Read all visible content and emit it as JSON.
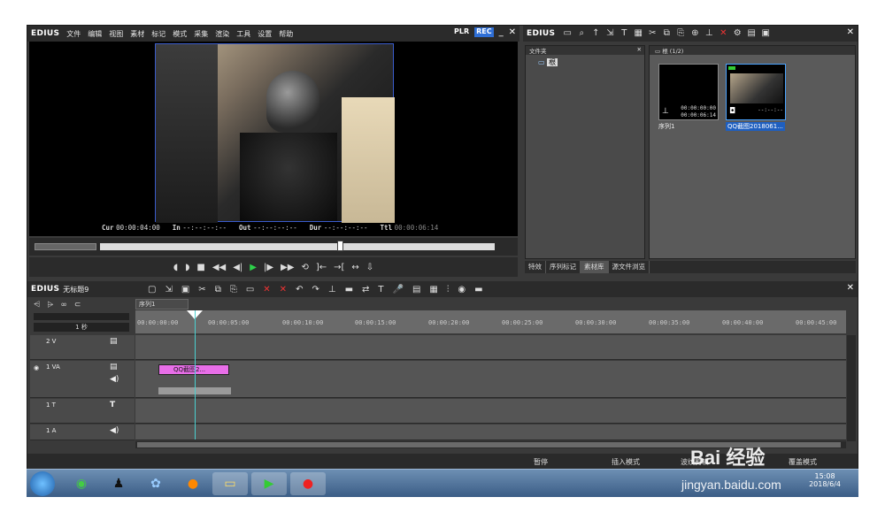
{
  "player": {
    "brand": "EDIUS",
    "menu": [
      "文件",
      "编辑",
      "视图",
      "素材",
      "标记",
      "模式",
      "采集",
      "渲染",
      "工具",
      "设置",
      "帮助"
    ],
    "plr": "PLR",
    "rec": "REC",
    "cur_label": "Cur",
    "cur_value": "00:00:04:00",
    "in_label": "In",
    "in_value": "--:--:--:--",
    "out_label": "Out",
    "out_value": "--:--:--:--",
    "dur_label": "Dur",
    "dur_value": "--:--:--:--",
    "ttl_label": "Ttl",
    "ttl_value": "00:00:06:14"
  },
  "bin": {
    "brand": "EDIUS",
    "folder_header": "文件夹",
    "root_folder": "根",
    "clip_header": "根 (1/2)",
    "clips": [
      {
        "name": "序列1",
        "tc1": "00:00:00:00",
        "tc2": "00:00:06:14"
      },
      {
        "name": "QQ截图2018061...",
        "tc1": "--:--:--",
        "tc2": "--:--:--"
      }
    ],
    "tabs": [
      "特效",
      "序列标记",
      "素材库",
      "源文件浏览"
    ]
  },
  "timeline": {
    "brand": "EDIUS",
    "project_name": "无标题9",
    "sequence_tab": "序列1",
    "scale": "1 秒",
    "ruler": [
      "00:00:00:00",
      "00:00:05:00",
      "00:00:10:00",
      "00:00:15:00",
      "00:00:20:00",
      "00:00:25:00",
      "00:00:30:00",
      "00:00:35:00",
      "00:00:40:00",
      "00:00:45:00"
    ],
    "tracks": [
      {
        "label": "2 V"
      },
      {
        "label": "1 VA"
      },
      {
        "label": "1 T"
      },
      {
        "label": "1 A"
      }
    ],
    "clip_label": "QQ截图2..."
  },
  "status": {
    "pause": "暂停",
    "insert_mode": "插入模式",
    "extra": "波纹剪辑",
    "overlay": "覆盖模式"
  },
  "taskbar": {
    "time": "15:08",
    "date": "2018/6/4"
  },
  "watermark": {
    "brand": "Bai 经验",
    "url": "jingyan.baidu.com"
  }
}
